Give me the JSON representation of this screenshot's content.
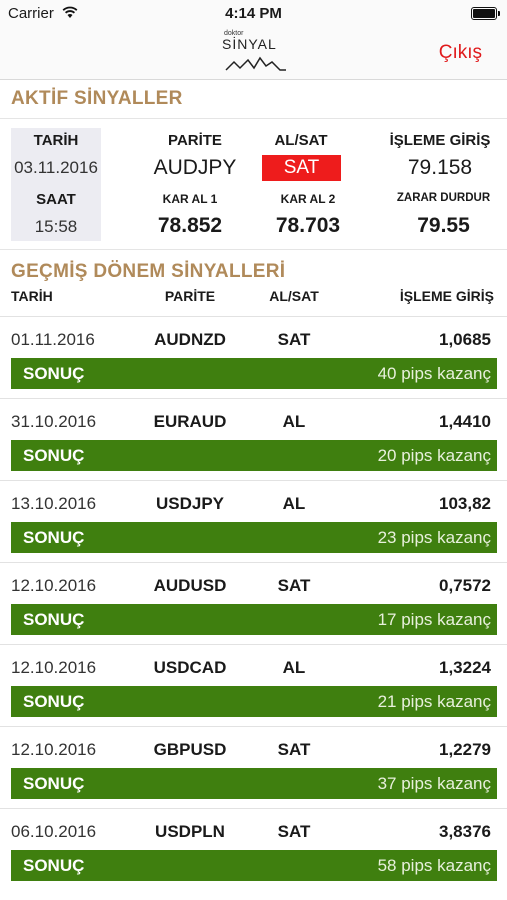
{
  "status_bar": {
    "carrier": "Carrier",
    "time": "4:14 PM"
  },
  "nav": {
    "logo_small": "doktor",
    "logo_main": "SİNYAL",
    "logout_label": "Çıkış"
  },
  "active": {
    "title": "AKTİF SİNYALLER",
    "date_label": "TARİH",
    "date_value": "03.11.2016",
    "time_label": "SAAT",
    "time_value": "15:58",
    "pair_label": "PARİTE",
    "pair_value": "AUDJPY",
    "side_label": "AL/SAT",
    "side_value": "SAT",
    "entry_label": "İŞLEME GİRİŞ",
    "entry_value": "79.158",
    "tp1_label": "KAR AL 1",
    "tp1_value": "78.852",
    "tp2_label": "KAR AL 2",
    "tp2_value": "78.703",
    "stop_label": "ZARAR DURDUR",
    "stop_value": "79.55",
    "sell_color": "#ee1c1c"
  },
  "history": {
    "title": "GEÇMİŞ DÖNEM SİNYALLERİ",
    "columns": {
      "date": "TARİH",
      "pair": "PARİTE",
      "side": "AL/SAT",
      "entry": "İŞLEME GİRİŞ"
    },
    "result_label": "SONUÇ",
    "result_color": "#3f7f0f",
    "rows": [
      {
        "date": "01.11.2016",
        "pair": "AUDNZD",
        "side": "SAT",
        "entry": "1,0685",
        "result": "40 pips kazanç"
      },
      {
        "date": "31.10.2016",
        "pair": "EURAUD",
        "side": "AL",
        "entry": "1,4410",
        "result": "20 pips kazanç"
      },
      {
        "date": "13.10.2016",
        "pair": "USDJPY",
        "side": "AL",
        "entry": "103,82",
        "result": "23 pips kazanç"
      },
      {
        "date": "12.10.2016",
        "pair": "AUDUSD",
        "side": "SAT",
        "entry": "0,7572",
        "result": "17 pips kazanç"
      },
      {
        "date": "12.10.2016",
        "pair": "USDCAD",
        "side": "AL",
        "entry": "1,3224",
        "result": "21 pips kazanç"
      },
      {
        "date": "12.10.2016",
        "pair": "GBPUSD",
        "side": "SAT",
        "entry": "1,2279",
        "result": "37 pips kazanç"
      },
      {
        "date": "06.10.2016",
        "pair": "USDPLN",
        "side": "SAT",
        "entry": "3,8376",
        "result": "58 pips kazanç"
      }
    ]
  },
  "brand": {
    "title_color": "#b08a5a",
    "logout_color": "#e0191b"
  }
}
